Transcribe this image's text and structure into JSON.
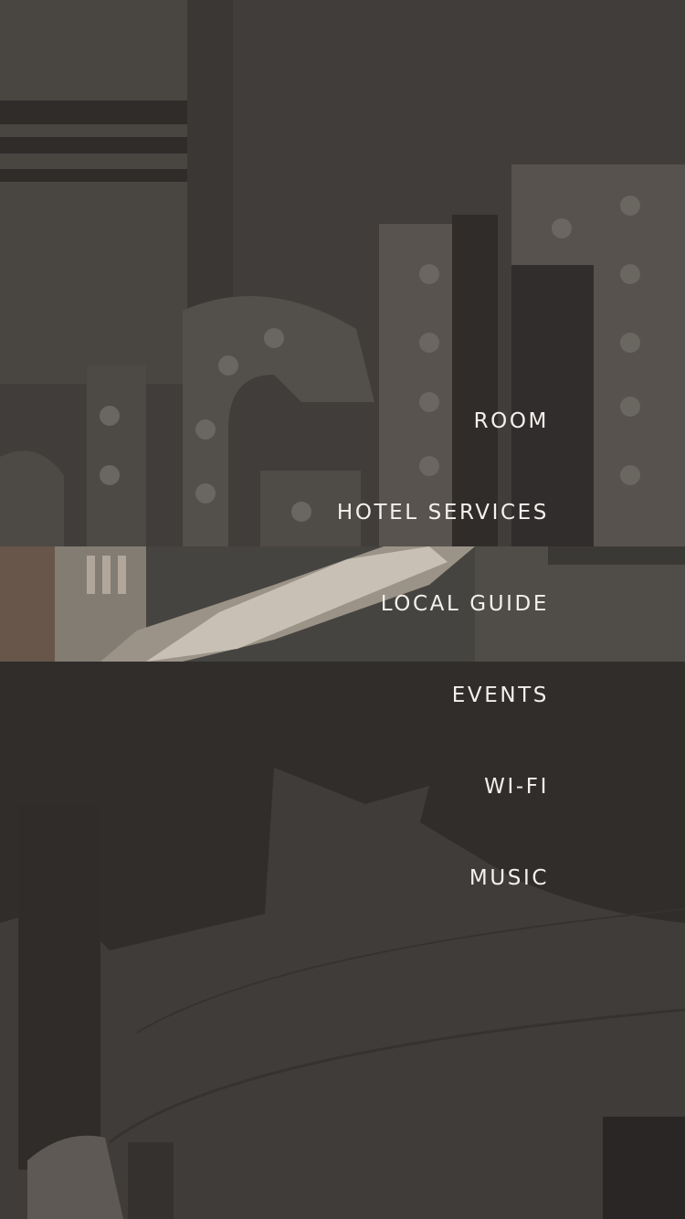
{
  "menu": {
    "items": [
      {
        "label": "ROOM",
        "active": false
      },
      {
        "label": "HOTEL SERVICES",
        "active": false
      },
      {
        "label": "LOCAL GUIDE",
        "active": true
      },
      {
        "label": "EVENTS",
        "active": false
      },
      {
        "label": "WI-FI",
        "active": false
      },
      {
        "label": "MUSIC",
        "active": false
      }
    ]
  },
  "background": {
    "overlay_color": "#282625",
    "text_color": "#f3f1ee"
  }
}
